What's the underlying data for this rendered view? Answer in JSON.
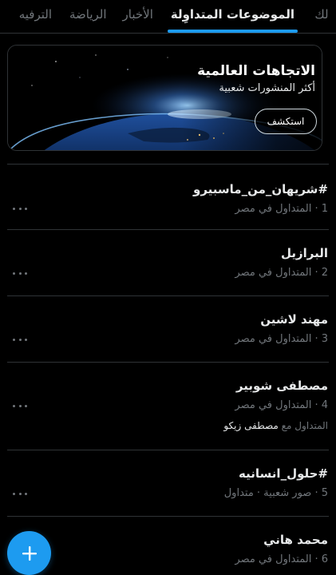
{
  "tabs": [
    {
      "label": "لك"
    },
    {
      "label": "الموضوعات المتداوِلة"
    },
    {
      "label": "الأخبار"
    },
    {
      "label": "الرياضة"
    },
    {
      "label": "الترفيه"
    }
  ],
  "banner": {
    "title": "الاتجاهات العالمية",
    "subtitle": "أكثر المنشورات شعبية",
    "button": "استكشف"
  },
  "trends": [
    {
      "title": "#شريهان_من_ماسبيرو",
      "meta": "1 · المتداول في مصر"
    },
    {
      "title": "البرازيل",
      "meta": "2 · المتداول في مصر"
    },
    {
      "title": "مهند لاشين",
      "meta": "3 · المتداول في مصر"
    },
    {
      "title": "مصطفى شوبير",
      "meta": "4 · المتداول في مصر",
      "extra_prefix": "المتداول مع",
      "extra_name": "مصطفى زيكو"
    },
    {
      "title": "#حلول_انسانيه",
      "meta": "5 · صور شعبية · متداول"
    },
    {
      "title": "محمد هاني",
      "meta": "6 · المتداول في مصر"
    }
  ],
  "icons": {
    "more": "more-horizontal-icon",
    "compose": "plus-icon",
    "banner_image": "earth-globe-image"
  },
  "colors": {
    "accent": "#1d9bf0",
    "background": "#000000",
    "text": "#e7e9ea",
    "secondary_text": "#71767b",
    "divider": "#2f3336"
  }
}
